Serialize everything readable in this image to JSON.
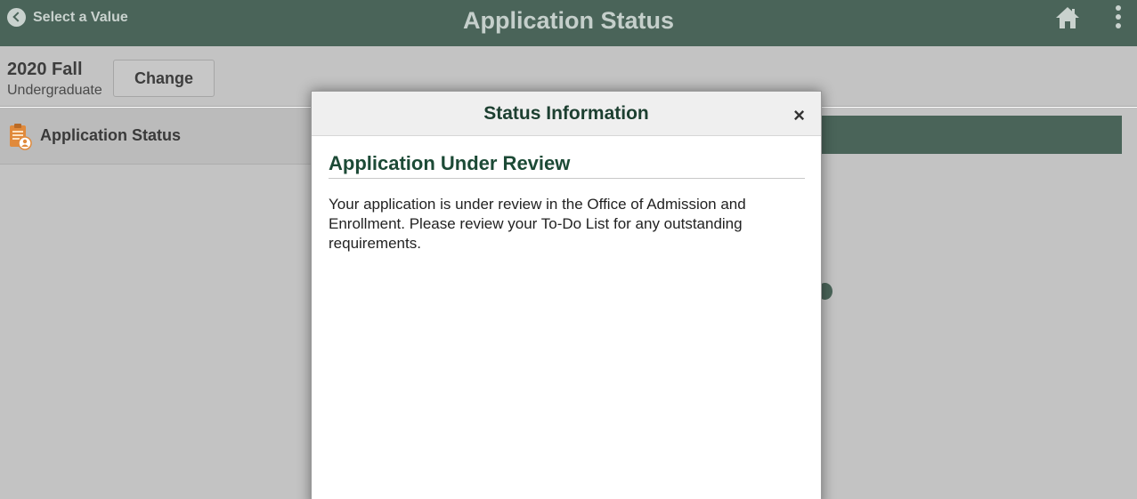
{
  "header": {
    "back_label": "Select a Value",
    "title": "Application Status",
    "icons": {
      "back": "chevron-left-circle-icon",
      "home": "home-icon",
      "menu": "kebab-menu-icon"
    }
  },
  "subbar": {
    "term": "2020 Fall",
    "career": "Undergraduate",
    "change_label": "Change"
  },
  "sidebar": {
    "items": [
      {
        "label": "Application Status",
        "icon": "application-document-icon"
      }
    ]
  },
  "modal": {
    "title": "Status Information",
    "close_label": "×",
    "heading": "Application Under Review",
    "body": "Your application is under review in the Office of Admission and Enrollment. Please review your To-Do List for any outstanding requirements."
  },
  "colors": {
    "header_bg": "#4a6459",
    "overlay_bg": "#c3c3c3",
    "modal_title": "#1c3f30",
    "heading_green": "#1c4a36",
    "nav_icon_orange": "#e08a3c"
  }
}
